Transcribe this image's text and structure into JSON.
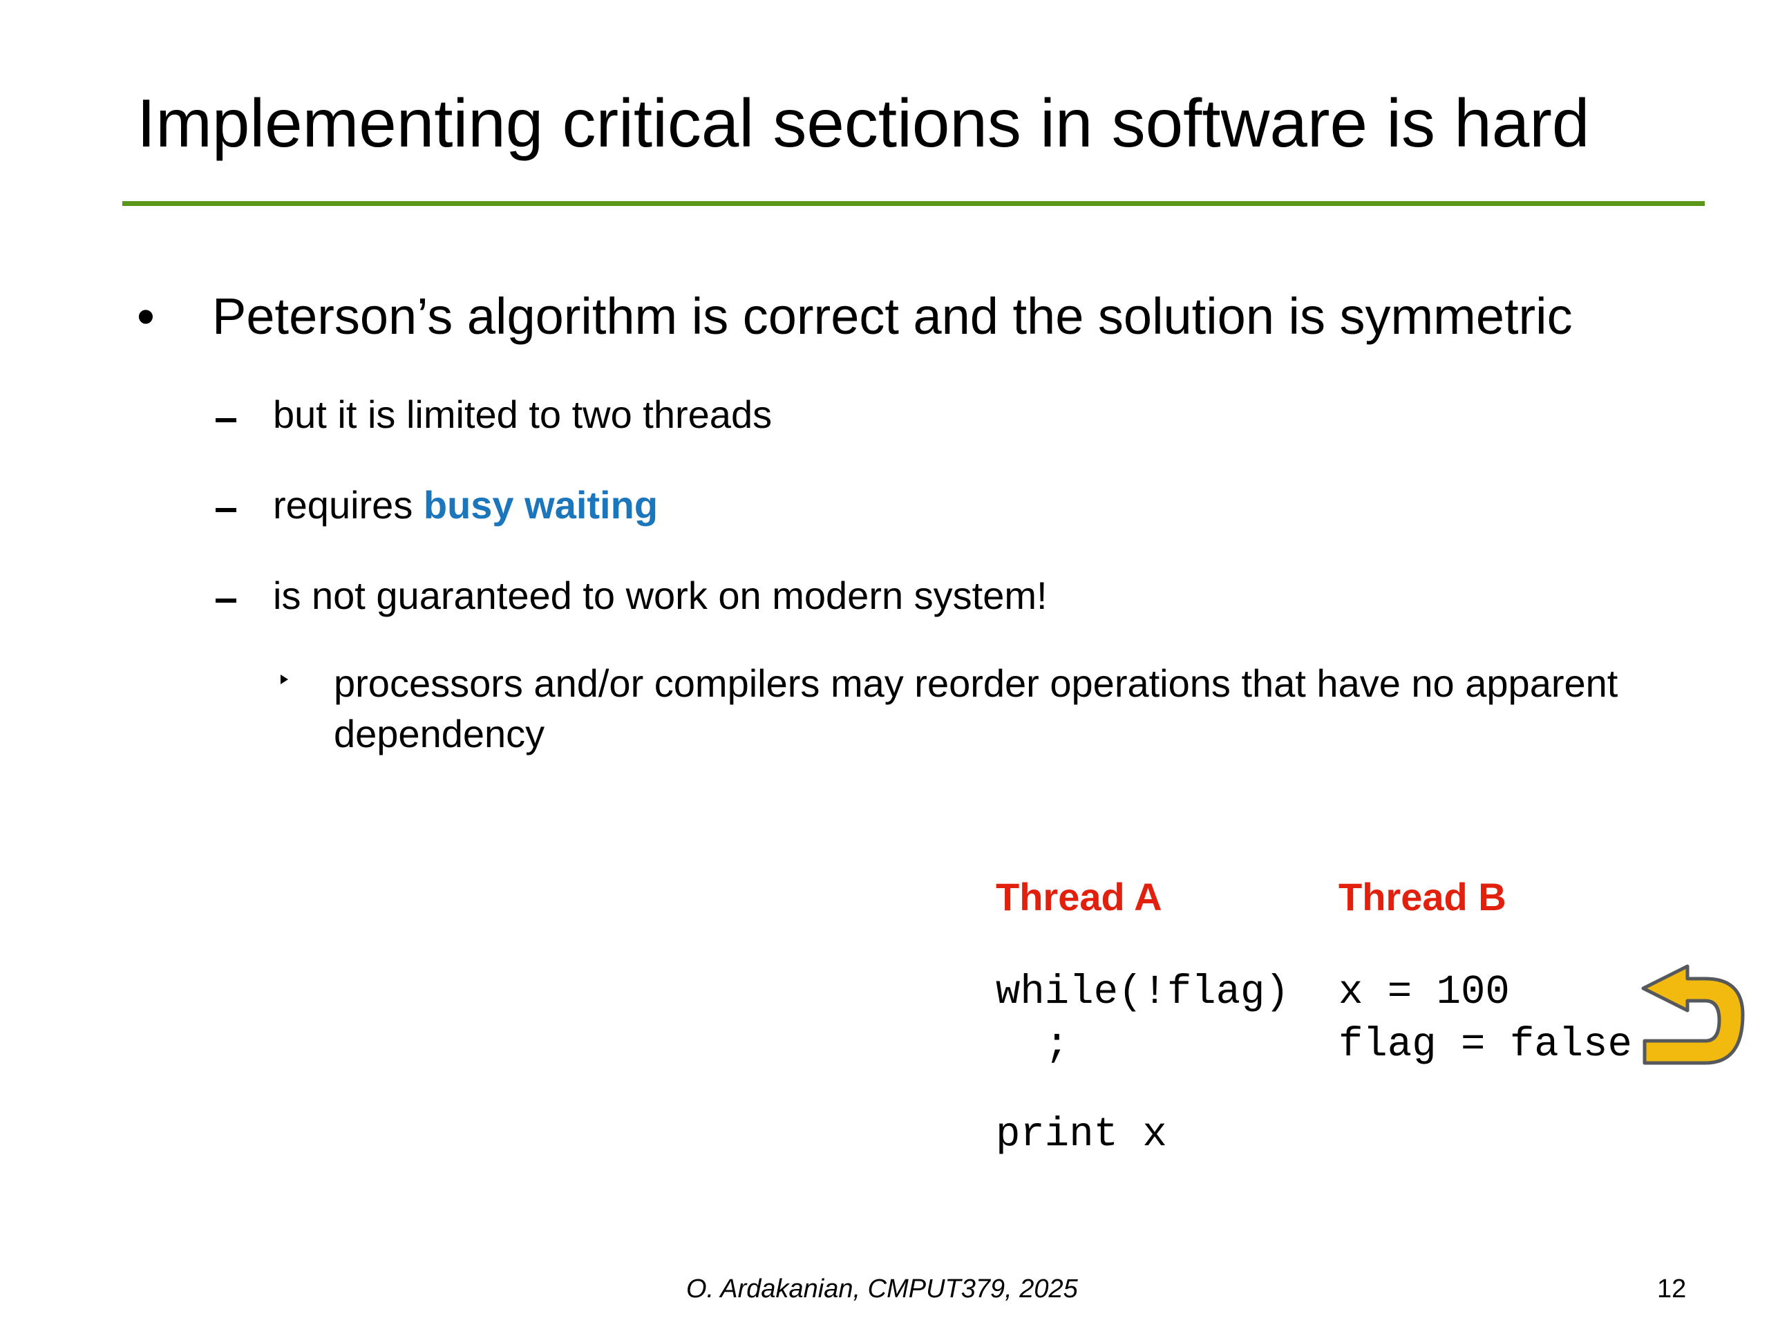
{
  "slide": {
    "title": "Implementing critical sections in software is hard",
    "bullet_marker": "•",
    "bullet": "Peterson’s algorithm is correct and the solution is symmetric",
    "sub_bullets": [
      {
        "text": "but it is limited to two threads"
      },
      {
        "prefix": "requires ",
        "highlight": "busy waiting"
      },
      {
        "text": "is not guaranteed to work on modern system!"
      }
    ],
    "sub_sub_bullet": "processors and/or compilers may reorder operations that have no apparent dependency"
  },
  "threads": {
    "a_label": "Thread A",
    "b_label": "Thread B",
    "a_code_1": "while(!flag)",
    "a_code_2": "  ;",
    "a_code_3": "print x",
    "b_code_1": "x = 100",
    "b_code_2": "flag = false"
  },
  "footer": {
    "credit": "O. Ardakanian, CMPUT379, 2025",
    "page_number": "12"
  },
  "colors": {
    "title_rule": "#5a9619",
    "highlight": "#1b76bb",
    "thread_label": "#e2200e",
    "return_arrow": "#f2b90f"
  },
  "icons": {
    "swap_indicator": "return-arrow-icon"
  }
}
